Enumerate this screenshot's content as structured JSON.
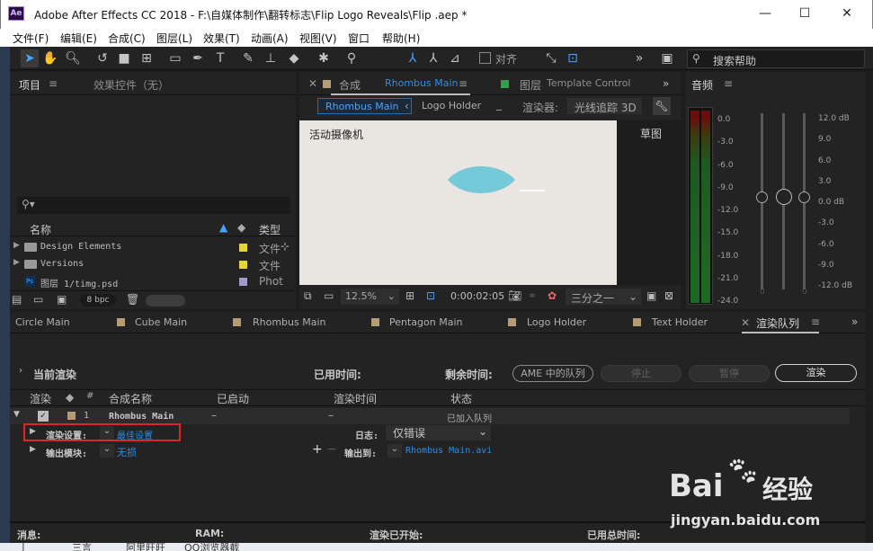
{
  "window": {
    "title": "Adobe After Effects CC 2018 - F:\\自媒体制作\\翻转标志\\Flip Logo Reveals\\Flip .aep *",
    "logo": "Ae",
    "minimize": "—",
    "maximize": "☐",
    "close": "✕"
  },
  "menu": [
    "文件(F)",
    "编辑(E)",
    "合成(C)",
    "图层(L)",
    "效果(T)",
    "动画(A)",
    "视图(V)",
    "窗口",
    "帮助(H)"
  ],
  "toolbar": {
    "snap_label": "对齐",
    "search_placeholder": "搜索帮助"
  },
  "project": {
    "tab_project": "项目",
    "tab_effects": "效果控件（无）",
    "col_name": "名称",
    "col_type": "类型",
    "items": [
      {
        "name": "Design Elements",
        "type": "文件",
        "color": "#e2d43c"
      },
      {
        "name": "Versions",
        "type": "文件",
        "color": "#e2d43c"
      },
      {
        "name": "图层 1/timg.psd",
        "type": "Phot",
        "color": "#a59ac7"
      }
    ],
    "bpc": "8 bpc"
  },
  "composition": {
    "tab_label": "合成",
    "comp_name": "Rhombus Main",
    "layer_tab": "图层",
    "layer_name": "Template Control",
    "sub_tabs": [
      "Rhombus Main",
      "Logo Holder"
    ],
    "renderer_label": "渲染器:",
    "renderer_value": "光线追踪 3D",
    "camera": "活动摄像机",
    "draft": "草图",
    "zoom": "12.5%",
    "timecode": "0:00:02:05",
    "resolution": "三分之一"
  },
  "audio": {
    "title": "音频",
    "left_scale": [
      "0.0",
      "-3.0",
      "-6.0",
      "-9.0",
      "-12.0",
      "-15.0",
      "-18.0",
      "-21.0",
      "-24.0"
    ],
    "right_scale": [
      "12.0 dB",
      "9.0",
      "6.0",
      "3.0",
      "0.0 dB",
      "-3.0",
      "-6.0",
      "-9.0",
      "-12.0 dB"
    ],
    "zeros": [
      "0",
      "0"
    ]
  },
  "timeline_tabs": [
    {
      "label": "Circle Main",
      "color": "#b59c74"
    },
    {
      "label": "Cube Main",
      "color": "#b59c74"
    },
    {
      "label": "Rhombus Main",
      "color": "#b59c74"
    },
    {
      "label": "Pentagon Main",
      "color": "#b59c74"
    },
    {
      "label": "Logo Holder",
      "color": "#b59c74"
    },
    {
      "label": "Text Holder",
      "color": "#b59c74"
    }
  ],
  "render_queue": {
    "tab_label": "渲染队列",
    "current_render": "当前渲染",
    "elapsed": "已用时间:",
    "remaining": "剩余时间:",
    "ame_button": "AME 中的队列",
    "stop_button": "停止",
    "pause_button": "暂停",
    "render_button": "渲染",
    "columns": [
      "渲染",
      "#",
      "合成名称",
      "已启动",
      "渲染时间",
      "状态"
    ],
    "item": {
      "number": "1",
      "comp": "Rhombus Main",
      "started": "–",
      "time": "–",
      "status": "已加入队列",
      "render_settings_label": "渲染设置:",
      "render_settings_value": "最佳设置",
      "log_label": "日志:",
      "log_value": "仅错误",
      "output_module_label": "输出模块:",
      "output_module_value": "无损",
      "output_to_label": "输出到:",
      "output_to_value": "Rhombus Main.avi"
    },
    "footer": {
      "message": "消息:",
      "ram": "RAM:",
      "render_started": "渲染已开始:",
      "total_time": "已用总时间:"
    }
  },
  "taskbar": [
    "|",
    "三言",
    "阿里旺旺",
    "QQ浏览器截"
  ],
  "watermark": {
    "brand_left": "Bai",
    "brand_right": "经验",
    "url": "jingyan.baidu.com"
  }
}
